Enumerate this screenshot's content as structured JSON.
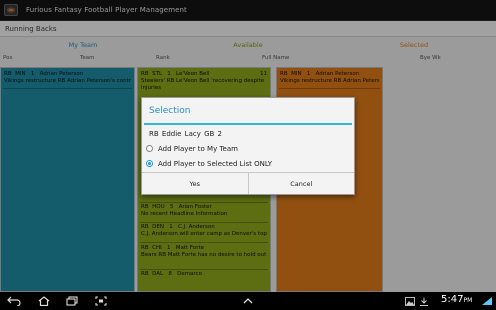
{
  "app": {
    "title": "Furious Fantasy Football Player Management",
    "icon": "football-app-icon"
  },
  "section": {
    "label": "Running Backs"
  },
  "columns": {
    "my_team": {
      "label": "My Team",
      "color": "#2a8ec2"
    },
    "available": {
      "label": "Available",
      "color": "#7d9b12"
    },
    "selected": {
      "label": "Selected",
      "color": "#e07c1a"
    }
  },
  "column_headers": [
    "Pos",
    "Team",
    "Rank",
    "Full Name",
    "Bye Wk"
  ],
  "panels": {
    "my_team": {
      "color": "#1f8ea6",
      "rows": [
        {
          "pos": "RB",
          "team": "MIN",
          "rank": "1",
          "name": "Adrian Peterson",
          "bye": "",
          "note": "Vikings restructure RB Adrian Peterson's contract"
        }
      ]
    },
    "available": {
      "color": "#8ea81c",
      "rows": [
        {
          "pos": "RB",
          "team": "STL",
          "rank": "1",
          "name": "Le'Veon Bell",
          "bye": "11",
          "note": "Steelers' RB Le'Veon Bell 'recovering despite"
        },
        {
          "pos": "",
          "team": "",
          "rank": "",
          "name": "",
          "bye": "",
          "note": "injuries"
        },
        {
          "pos": "RB",
          "team": "HOU",
          "rank": "5",
          "name": "Arian Foster",
          "bye": "",
          "note": "No recent Headline Information"
        },
        {
          "pos": "RB",
          "team": "DEN",
          "rank": "1",
          "name": "C.J. Anderson",
          "bye": "",
          "note": "C.J. Anderson will enter camp as Denver's top RB"
        },
        {
          "pos": "RB",
          "team": "CHI",
          "rank": "1",
          "name": "Matt Forte",
          "bye": "",
          "note": "Bears RB Matt Forte has no desire to hold out over contract"
        },
        {
          "pos": "RB",
          "team": "DAL",
          "rank": "8",
          "name": "Demarco",
          "bye": "",
          "note": ""
        }
      ]
    },
    "selected": {
      "color": "#e07c1a",
      "rows": [
        {
          "pos": "RB",
          "team": "MIN",
          "rank": "1",
          "name": "Adrian Peterson",
          "bye": "",
          "note": "Vikings restructure RB Adrian Peterson's contract"
        }
      ]
    }
  },
  "dialog": {
    "title": "Selection",
    "player": "RB  Eddie Lacy  GB  2",
    "options": [
      {
        "label": "Add Player to My Team",
        "selected": false
      },
      {
        "label": "Add Player to Selected List ONLY",
        "selected": true
      }
    ],
    "yes_label": "Yes",
    "cancel_label": "Cancel",
    "accent": "#33b5e5"
  },
  "navbar": {
    "icons": [
      "back-icon",
      "home-icon",
      "recent-apps-icon",
      "screenshot-icon",
      "up-chevron-icon",
      "picture-icon",
      "download-icon",
      "signal-icon"
    ],
    "time": "5:47",
    "ampm": "PM"
  }
}
